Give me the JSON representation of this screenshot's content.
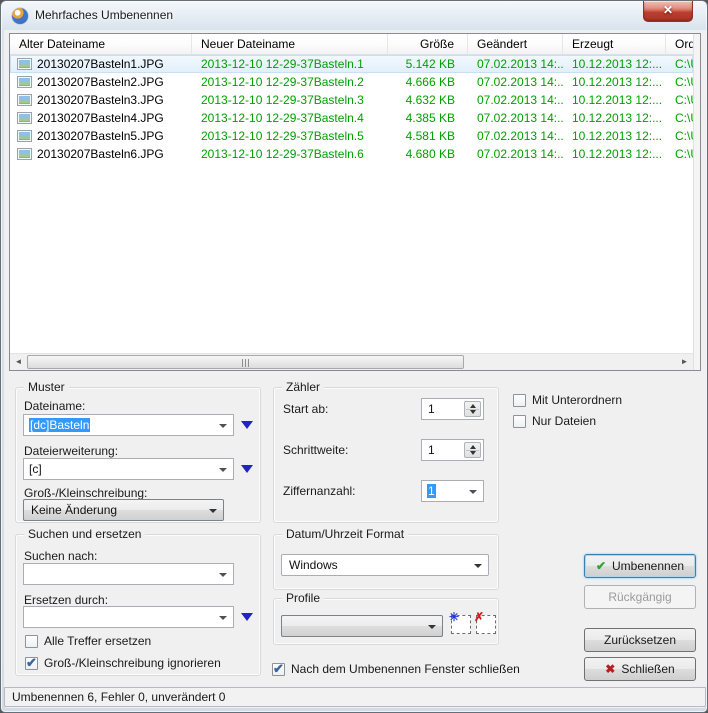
{
  "window": {
    "title": "Mehrfaches Umbenennen",
    "close_label": "x"
  },
  "table": {
    "columns": [
      "Alter Dateiname",
      "Neuer Dateiname",
      "Größe",
      "Geändert",
      "Erzeugt",
      "Ord"
    ],
    "rows": [
      {
        "old": "20130207Basteln1.JPG",
        "new": "2013-12-10 12-29-37Basteln.1",
        "size": "5.142 KB",
        "modified": "07.02.2013 14:...",
        "created": "10.12.2013 12:...",
        "folder": "C:\\U"
      },
      {
        "old": "20130207Basteln2.JPG",
        "new": "2013-12-10 12-29-37Basteln.2",
        "size": "4.666 KB",
        "modified": "07.02.2013 14:...",
        "created": "10.12.2013 12:...",
        "folder": "C:\\U"
      },
      {
        "old": "20130207Basteln3.JPG",
        "new": "2013-12-10 12-29-37Basteln.3",
        "size": "4.632 KB",
        "modified": "07.02.2013 14:...",
        "created": "10.12.2013 12:...",
        "folder": "C:\\U"
      },
      {
        "old": "20130207Basteln4.JPG",
        "new": "2013-12-10 12-29-37Basteln.4",
        "size": "4.385 KB",
        "modified": "07.02.2013 14:...",
        "created": "10.12.2013 12:...",
        "folder": "C:\\U"
      },
      {
        "old": "20130207Basteln5.JPG",
        "new": "2013-12-10 12-29-37Basteln.5",
        "size": "4.581 KB",
        "modified": "07.02.2013 14:...",
        "created": "10.12.2013 12:...",
        "folder": "C:\\U"
      },
      {
        "old": "20130207Basteln6.JPG",
        "new": "2013-12-10 12-29-37Basteln.6",
        "size": "4.680 KB",
        "modified": "07.02.2013 14:...",
        "created": "10.12.2013 12:...",
        "folder": "C:\\U"
      }
    ]
  },
  "muster": {
    "title": "Muster",
    "dateiname_label": "Dateiname:",
    "dateiname_value": "[dc]Basteln",
    "dateierweiterung_label": "Dateierweiterung:",
    "dateierweiterung_value": "[c]",
    "gross_klein_label": "Groß-/Kleinschreibung:",
    "gross_klein_value": "Keine Änderung"
  },
  "zaehler": {
    "title": "Zähler",
    "start_label": "Start ab:",
    "start_value": "1",
    "schritt_label": "Schrittweite:",
    "schritt_value": "1",
    "ziffern_label": "Ziffernanzahl:",
    "ziffern_value": "1"
  },
  "options": {
    "unterordner_label": "Mit Unterordnern",
    "nur_dateien_label": "Nur Dateien"
  },
  "suchen": {
    "title": "Suchen und ersetzen",
    "suchen_label": "Suchen nach:",
    "ersetzen_label": "Ersetzen durch:",
    "alle_treffer_label": "Alle Treffer ersetzen",
    "ignorieren_label": "Groß-/Kleinschreibung ignorieren"
  },
  "datum": {
    "title": "Datum/Uhrzeit Format",
    "value": "Windows"
  },
  "profile": {
    "title": "Profile",
    "value": ""
  },
  "buttons": {
    "umbenennen": "Umbenennen",
    "rueckgaengig": "Rückgängig",
    "zuruecksetzen": "Zurücksetzen",
    "schliessen": "Schließen"
  },
  "footer": {
    "close_after_label": "Nach dem Umbenennen Fenster schließen"
  },
  "statusbar": {
    "text": "Umbenennen 6, Fehler 0, unverändert 0"
  },
  "colors": {
    "new_name_green": "#00a000",
    "selection_blue": "#3399ff"
  }
}
